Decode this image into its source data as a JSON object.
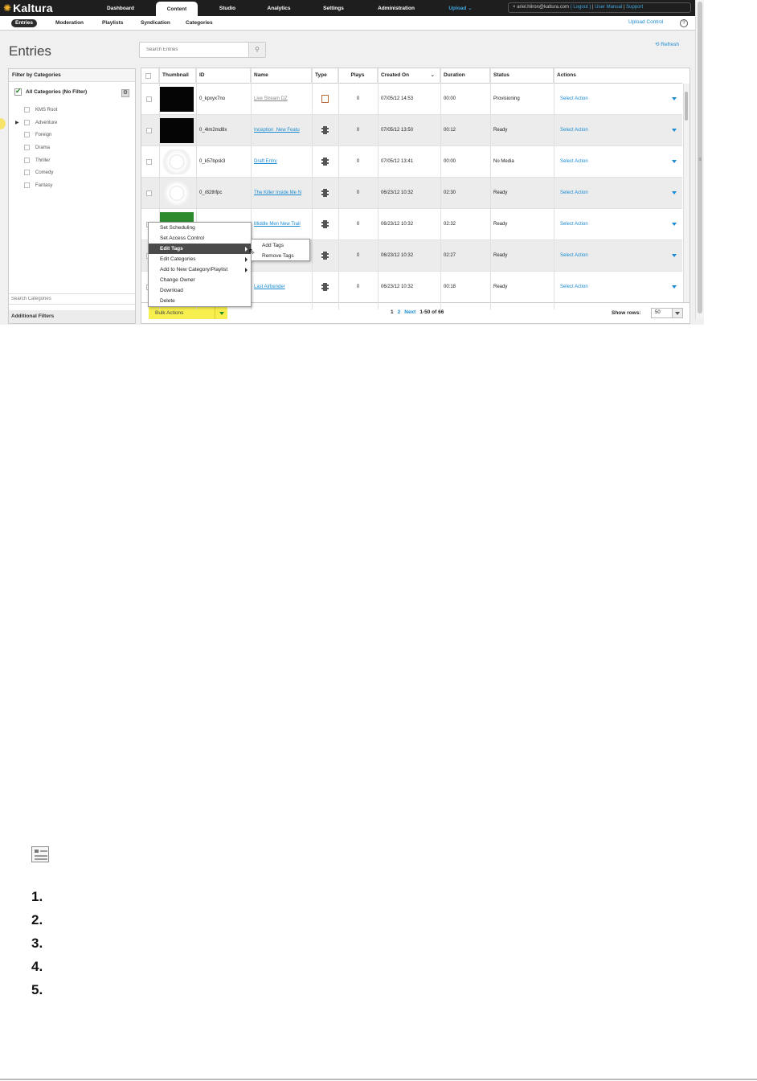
{
  "app": {
    "logo": "Kaltura"
  },
  "topnav": {
    "items": [
      "Dashboard",
      "Content",
      "Studio",
      "Analytics",
      "Settings",
      "Administration"
    ],
    "active": "Content",
    "upload": "Upload",
    "user_email": "ariel.hilron@kaltura.com",
    "logout": "( Logout )",
    "user_manual": "User Manual",
    "support": "Support"
  },
  "subnav": {
    "items": [
      "Entries",
      "Moderation",
      "Playlists",
      "Syndication",
      "Categories"
    ],
    "active": "Entries",
    "upload_control": "Upload Control",
    "help": "?"
  },
  "page": {
    "title": "Entries",
    "search_placeholder": "Search Entries",
    "refresh": "Refresh"
  },
  "filters": {
    "title": "Filter by Categories",
    "all": "All Categories (No Filter)",
    "categories": [
      "KMS Root",
      "Adventure",
      "Foreign",
      "Drama",
      "Thriller",
      "Comedy",
      "Fantasy"
    ],
    "search_placeholder": "Search Categories",
    "additional": "Additional Filters"
  },
  "grid": {
    "columns": [
      "Thumbnail",
      "ID",
      "Name",
      "Type",
      "Plays",
      "Created On",
      "Duration",
      "Status",
      "Actions"
    ],
    "sort_indicator": "⌄",
    "rows": [
      {
        "id": "0_kpxyx7no",
        "name": "Live Stream DZ",
        "type": "live",
        "plays": "0",
        "created": "07/05/12 14:53",
        "duration": "00:00",
        "status": "Provisioning",
        "action": "Select Action"
      },
      {
        "id": "0_4lm2md8x",
        "name": "Inception_New Featu",
        "type": "video",
        "plays": "0",
        "created": "07/05/12 13:50",
        "duration": "00:12",
        "status": "Ready",
        "action": "Select Action"
      },
      {
        "id": "0_k57bpsk3",
        "name": "Draft Entry",
        "type": "video",
        "plays": "0",
        "created": "07/05/12 13:41",
        "duration": "00:00",
        "status": "No Media",
        "action": "Select Action"
      },
      {
        "id": "0_r82thfpc",
        "name": "The Killer Inside Me N",
        "type": "video",
        "plays": "0",
        "created": "06/23/12 10:32",
        "duration": "02:30",
        "status": "Ready",
        "action": "Select Action"
      },
      {
        "id": "",
        "name": "Middle Men New Trail",
        "type": "video",
        "plays": "0",
        "created": "06/23/12 10:32",
        "duration": "02:32",
        "status": "Ready",
        "action": "Select Action"
      },
      {
        "id": "",
        "name": "",
        "type": "video",
        "plays": "0",
        "created": "06/23/12 10:32",
        "duration": "02:27",
        "status": "Ready",
        "action": "Select Action"
      },
      {
        "id": "",
        "name": "Last Airbender",
        "type": "video",
        "plays": "0",
        "created": "06/23/12 10:32",
        "duration": "00:18",
        "status": "Ready",
        "action": "Select Action"
      }
    ],
    "bulk_actions": "Bulk Actions",
    "pager": {
      "page1": "1",
      "page2": "2",
      "next": "Next",
      "range": "1-50 of 66"
    },
    "show_rows_label": "Show rows:",
    "show_rows_value": "50"
  },
  "context_menu": {
    "items": [
      "Set Scheduling",
      "Set Access Control",
      "Edit Tags",
      "Edit Categories",
      "Add to New Category/Playlist",
      "Change Owner",
      "Download",
      "Delete"
    ],
    "highlighted": "Edit Tags",
    "submenu": [
      "Add Tags",
      "Remove Tags"
    ]
  },
  "document": {
    "steps": [
      "1.",
      "2.",
      "3.",
      "4.",
      "5."
    ]
  }
}
